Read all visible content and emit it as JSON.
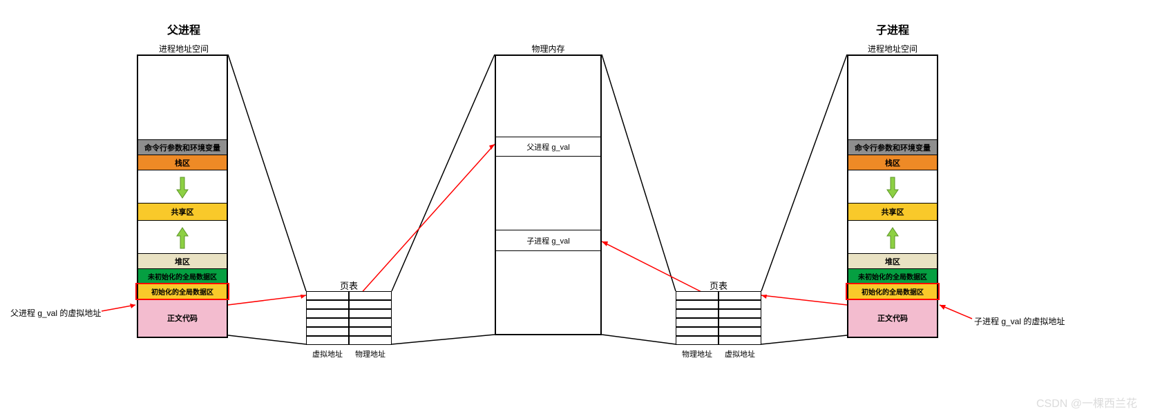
{
  "parent": {
    "title": "父进程",
    "subtitle": "进程地址空间",
    "segments": {
      "cmdenv": "命令行参数和环境变量",
      "stack": "栈区",
      "shared": "共享区",
      "heap": "堆区",
      "uninit": "未初始化的全局数据区",
      "init": "初始化的全局数据区",
      "text": "正文代码"
    },
    "page_table_title": "页表",
    "col_left": "虚拟地址",
    "col_right": "物理地址",
    "pointer_label": "父进程 g_val 的虚拟地址"
  },
  "child": {
    "title": "子进程",
    "subtitle": "进程地址空间",
    "segments": {
      "cmdenv": "命令行参数和环境变量",
      "stack": "栈区",
      "shared": "共享区",
      "heap": "堆区",
      "uninit": "未初始化的全局数据区",
      "init": "初始化的全局数据区",
      "text": "正文代码"
    },
    "page_table_title": "页表",
    "col_left": "物理地址",
    "col_right": "虚拟地址",
    "pointer_label": "子进程 g_val 的虚拟地址"
  },
  "physmem": {
    "title": "物理内存",
    "parent_gval": "父进程 g_val",
    "child_gval": "子进程 g_val"
  },
  "watermark": "CSDN @一棵西兰花"
}
